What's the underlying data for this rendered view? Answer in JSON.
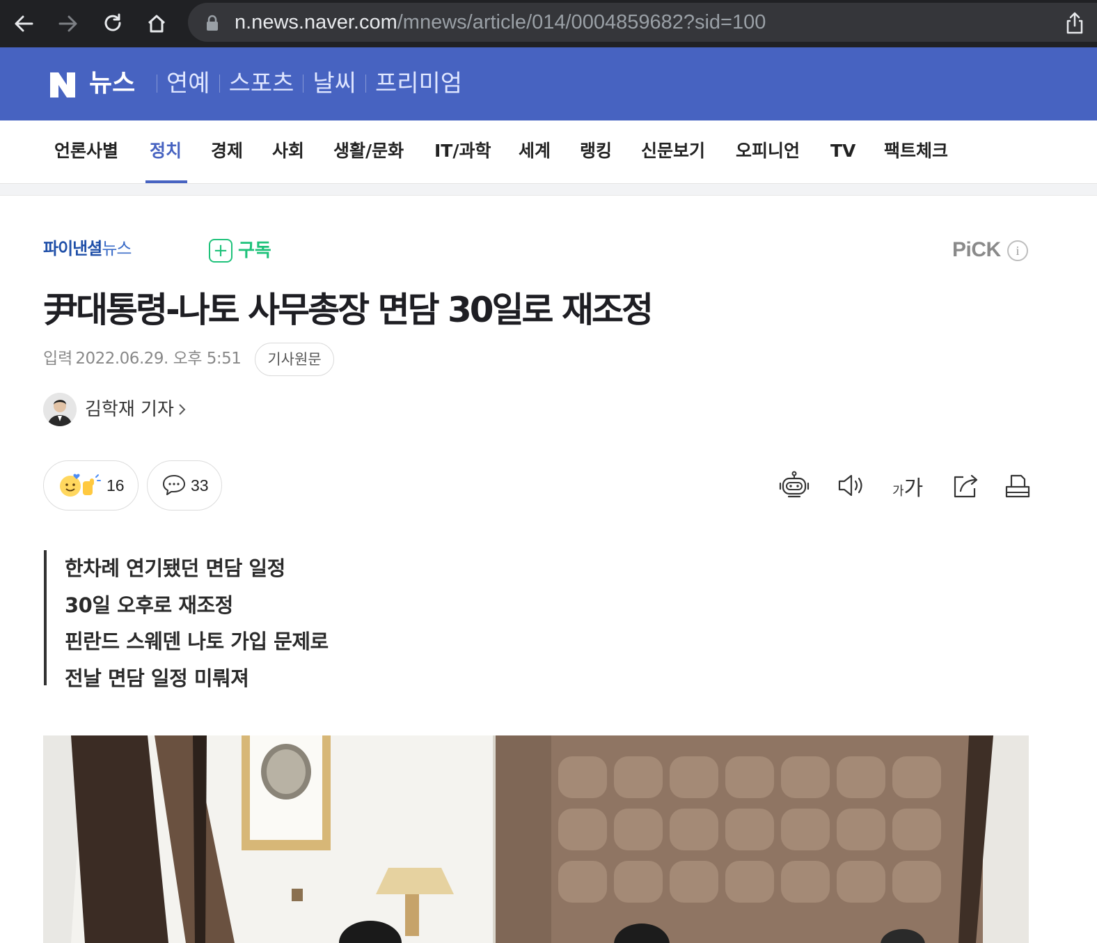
{
  "browser": {
    "url_host": "n.news.naver.com",
    "url_path": "/mnews/article/014/0004859682?sid=100"
  },
  "header": {
    "logo": "N",
    "title": "뉴스",
    "links": [
      "연예",
      "스포츠",
      "날씨",
      "프리미엄"
    ]
  },
  "nav": {
    "items": [
      "언론사별",
      "정치",
      "경제",
      "사회",
      "생활/문화",
      "IT/과학",
      "세계",
      "랭킹",
      "신문보기",
      "오피니언",
      "TV",
      "팩트체크"
    ],
    "active": "정치"
  },
  "press": {
    "name_bold": "파이낸셜",
    "name_light": "뉴스",
    "subscribe_label": "구독",
    "pick_label": "PiCK",
    "pick_info": "i"
  },
  "article": {
    "title": "尹대통령-나토 사무총장 면담 30일로 재조정",
    "date_label": "입력",
    "date_value": "2022.06.29. 오후 5:51",
    "original_button": "기사원문",
    "reporter": "김학재 기자",
    "likes": "16",
    "comments": "33",
    "font_small": "가",
    "font_large": "가",
    "summary": [
      "한차례 연기됐던 면담 일정",
      "30일 오후로 재조정",
      "핀란드 스웨덴 나토 가입 문제로",
      "전날 면담 일정 미뤄져"
    ]
  },
  "icons": {
    "back": "arrow-left-icon",
    "forward": "arrow-right-icon",
    "reload": "reload-icon",
    "home": "home-icon",
    "lock": "lock-icon",
    "share": "share-icon",
    "summary_bot": "robot-icon",
    "tts": "speaker-icon",
    "share_article": "share-arrow-icon",
    "print": "print-icon"
  },
  "colors": {
    "brand_header": "#4763c1",
    "subscribe_green": "#1ec27a",
    "press_blue": "#1f4fa8"
  }
}
